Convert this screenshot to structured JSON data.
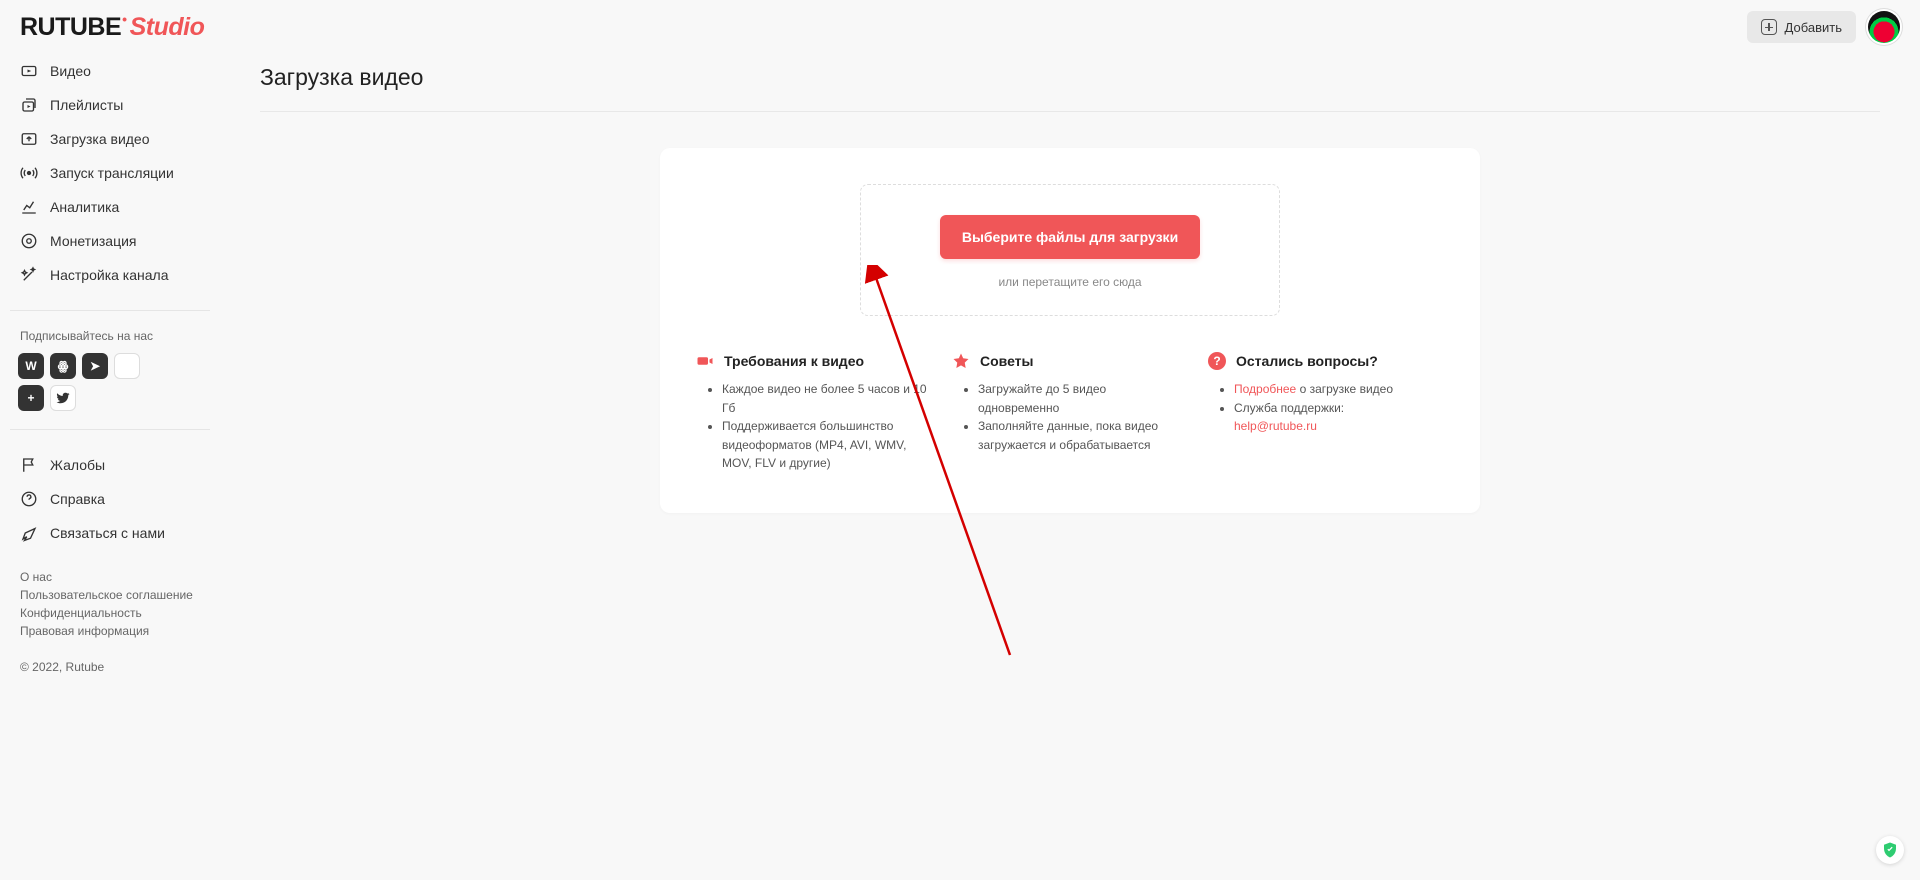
{
  "header": {
    "logo_text": "RUTUBE",
    "logo_studio": "Studio",
    "add_button": "Добавить"
  },
  "sidebar": {
    "nav": [
      {
        "label": "Видео"
      },
      {
        "label": "Плейлисты"
      },
      {
        "label": "Загрузка видео"
      },
      {
        "label": "Запуск трансляции"
      },
      {
        "label": "Аналитика"
      },
      {
        "label": "Монетизация"
      },
      {
        "label": "Настройка канала"
      }
    ],
    "follow_label": "Подписывайтесь на нас",
    "socials": [
      {
        "name": "vk",
        "glyph": "W"
      },
      {
        "name": "ok",
        "glyph": "ꙮ"
      },
      {
        "name": "telegram",
        "glyph": "➤"
      },
      {
        "name": "blank",
        "glyph": ""
      },
      {
        "name": "plus",
        "glyph": "+"
      },
      {
        "name": "twitter",
        "glyph": "𝕏"
      }
    ],
    "secondary_nav": [
      {
        "label": "Жалобы"
      },
      {
        "label": "Справка"
      },
      {
        "label": "Связаться с нами"
      }
    ],
    "footer_links": [
      "О нас",
      "Пользовательское соглашение",
      "Конфиденциальность",
      "Правовая информация"
    ],
    "copyright": "© 2022, Rutube"
  },
  "main": {
    "page_title": "Загрузка видео",
    "upload_button": "Выберите файлы для загрузки",
    "drag_hint": "или перетащите его сюда",
    "cols": {
      "requirements": {
        "title": "Требования к видео",
        "items": [
          "Каждое видео не более 5 часов и 10 Гб",
          "Поддерживается большинство видеоформатов (MP4, AVI, WMV, MOV, FLV и другие)"
        ]
      },
      "tips": {
        "title": "Советы",
        "items": [
          "Загружайте до 5 видео одновременно",
          "Заполняйте данные, пока видео загружается и обрабатывается"
        ]
      },
      "questions": {
        "title": "Остались вопросы?",
        "more_link": "Подробнее",
        "more_suffix": " о загрузке видео",
        "support_prefix": "Служба поддержки: ",
        "support_email": "help@rutube.ru"
      }
    }
  }
}
